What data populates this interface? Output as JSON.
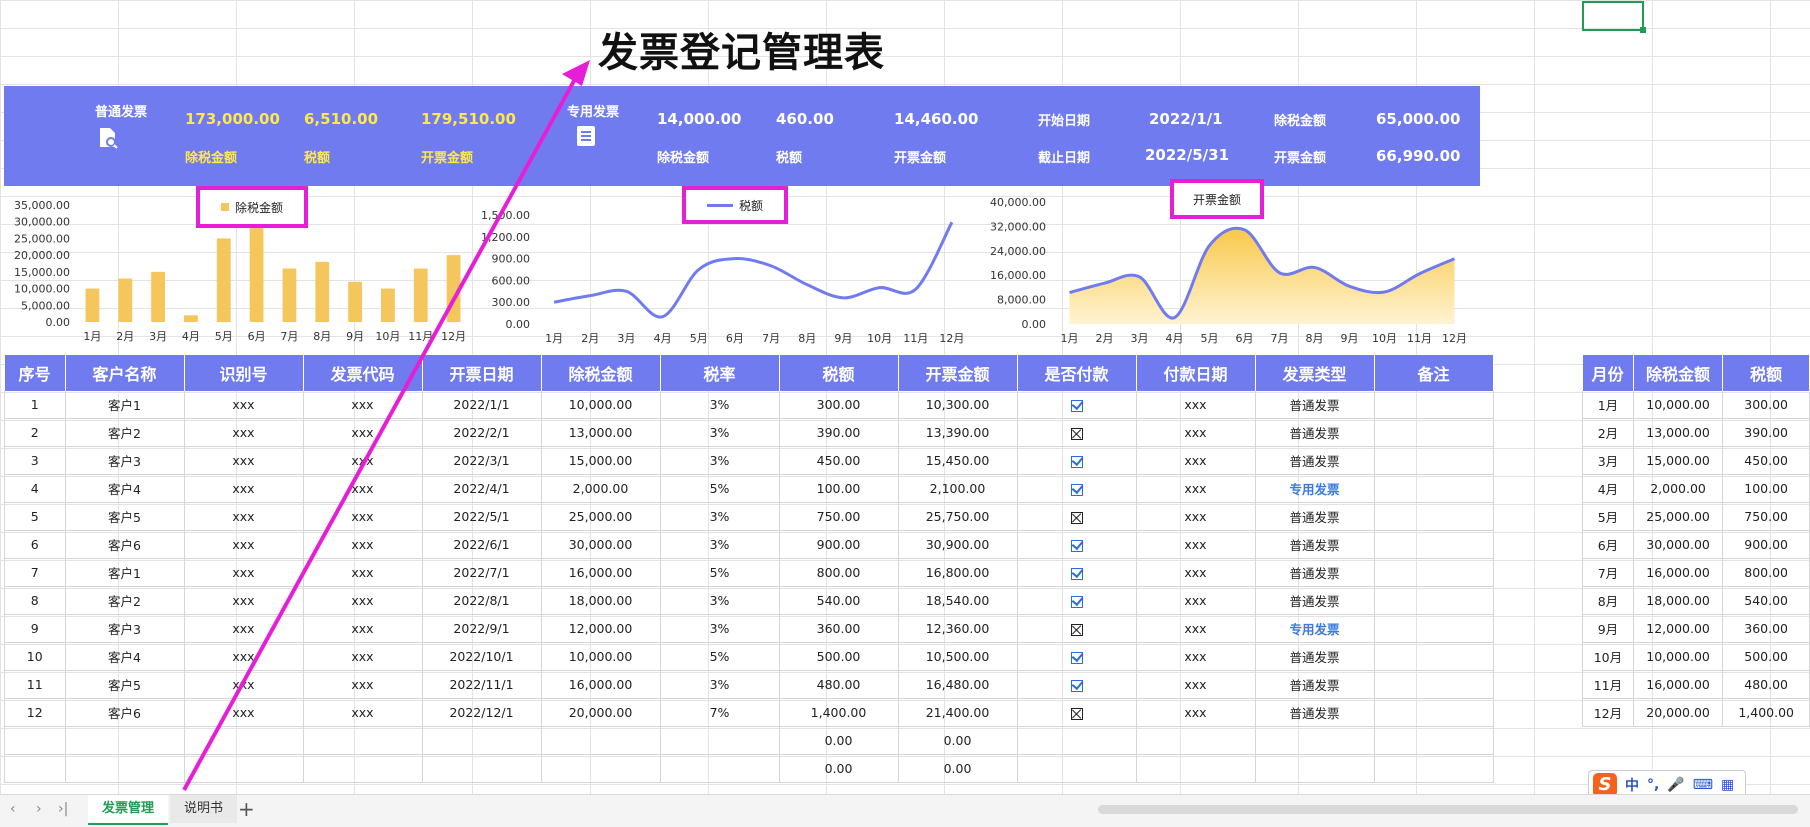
{
  "title": "发票登记管理表",
  "summary": {
    "ordinary_label": "普通发票",
    "ordinary_pretax": "173,000.00",
    "ordinary_tax": "6,510.00",
    "ordinary_total": "179,510.00",
    "ordinary_pretax_label": "除税金额",
    "ordinary_tax_label": "税额",
    "ordinary_total_label": "开票金额",
    "special_label": "专用发票",
    "special_pretax": "14,000.00",
    "special_tax": "460.00",
    "special_total": "14,460.00",
    "special_pretax_label": "除税金额",
    "special_tax_label": "税额",
    "special_total_label": "开票金额",
    "start_label": "开始日期",
    "start_value": "2022/1/1",
    "end_label": "截止日期",
    "end_value": "2022/5/31",
    "range_pretax_label": "除税金额",
    "range_pretax_value": "65,000.00",
    "range_total_label": "开票金额",
    "range_total_value": "66,990.00"
  },
  "chart_data": [
    {
      "type": "bar",
      "categories": [
        "1月",
        "2月",
        "3月",
        "4月",
        "5月",
        "6月",
        "7月",
        "8月",
        "9月",
        "10月",
        "11月",
        "12月"
      ],
      "series": [
        {
          "name": "除税金额",
          "values": [
            10000,
            13000,
            15000,
            2000,
            25000,
            30000,
            16000,
            18000,
            12000,
            10000,
            16000,
            20000
          ]
        }
      ],
      "yticks": [
        "35,000.00",
        "30,000.00",
        "25,000.00",
        "20,000.00",
        "15,000.00",
        "10,000.00",
        "5,000.00",
        "0.00"
      ],
      "ylim": [
        0,
        35000
      ],
      "legend": "top-center",
      "color": "#f5c65c"
    },
    {
      "type": "line",
      "categories": [
        "1月",
        "2月",
        "3月",
        "4月",
        "5月",
        "6月",
        "7月",
        "8月",
        "9月",
        "10月",
        "11月",
        "12月"
      ],
      "series": [
        {
          "name": "税额",
          "values": [
            300,
            390,
            450,
            100,
            750,
            900,
            800,
            540,
            360,
            500,
            480,
            1400
          ]
        }
      ],
      "yticks": [
        "1,500.00",
        "1,200.00",
        "900.00",
        "600.00",
        "300.00",
        "0.00"
      ],
      "ylim": [
        0,
        1500
      ],
      "legend": "top-center",
      "color": "#6f7bef"
    },
    {
      "type": "area",
      "categories": [
        "1月",
        "2月",
        "3月",
        "4月",
        "5月",
        "6月",
        "7月",
        "8月",
        "9月",
        "10月",
        "11月",
        "12月"
      ],
      "series": [
        {
          "name": "开票金额",
          "values": [
            10300,
            13390,
            15450,
            2100,
            25750,
            30900,
            16800,
            18540,
            12360,
            10500,
            16480,
            21400
          ]
        }
      ],
      "yticks": [
        "40,000.00",
        "32,000.00",
        "24,000.00",
        "16,000.00",
        "8,000.00",
        "0.00"
      ],
      "ylim": [
        0,
        40000
      ],
      "legend": "top-center",
      "color": "#6f7bef"
    }
  ],
  "table": {
    "headers": [
      "序号",
      "客户名称",
      "识别号",
      "发票代码",
      "开票日期",
      "除税金额",
      "税率",
      "税额",
      "开票金额",
      "是否付款",
      "付款日期",
      "发票类型",
      "备注"
    ],
    "rows": [
      [
        "1",
        "客户1",
        "xxx",
        "xxx",
        "2022/1/1",
        "10,000.00",
        "3%",
        "300.00",
        "10,300.00",
        true,
        "xxx",
        "普通发票",
        ""
      ],
      [
        "2",
        "客户2",
        "xxx",
        "xxx",
        "2022/2/1",
        "13,000.00",
        "3%",
        "390.00",
        "13,390.00",
        false,
        "xxx",
        "普通发票",
        ""
      ],
      [
        "3",
        "客户3",
        "xxx",
        "xxx",
        "2022/3/1",
        "15,000.00",
        "3%",
        "450.00",
        "15,450.00",
        true,
        "xxx",
        "普通发票",
        ""
      ],
      [
        "4",
        "客户4",
        "xxx",
        "xxx",
        "2022/4/1",
        "2,000.00",
        "5%",
        "100.00",
        "2,100.00",
        true,
        "xxx",
        "专用发票",
        ""
      ],
      [
        "5",
        "客户5",
        "xxx",
        "xxx",
        "2022/5/1",
        "25,000.00",
        "3%",
        "750.00",
        "25,750.00",
        false,
        "xxx",
        "普通发票",
        ""
      ],
      [
        "6",
        "客户6",
        "xxx",
        "xxx",
        "2022/6/1",
        "30,000.00",
        "3%",
        "900.00",
        "30,900.00",
        true,
        "xxx",
        "普通发票",
        ""
      ],
      [
        "7",
        "客户1",
        "xxx",
        "xxx",
        "2022/7/1",
        "16,000.00",
        "5%",
        "800.00",
        "16,800.00",
        true,
        "xxx",
        "普通发票",
        ""
      ],
      [
        "8",
        "客户2",
        "xxx",
        "xxx",
        "2022/8/1",
        "18,000.00",
        "3%",
        "540.00",
        "18,540.00",
        true,
        "xxx",
        "普通发票",
        ""
      ],
      [
        "9",
        "客户3",
        "xxx",
        "xxx",
        "2022/9/1",
        "12,000.00",
        "3%",
        "360.00",
        "12,360.00",
        false,
        "xxx",
        "专用发票",
        ""
      ],
      [
        "10",
        "客户4",
        "xxx",
        "xxx",
        "2022/10/1",
        "10,000.00",
        "5%",
        "500.00",
        "10,500.00",
        true,
        "xxx",
        "普通发票",
        ""
      ],
      [
        "11",
        "客户5",
        "xxx",
        "xxx",
        "2022/11/1",
        "16,000.00",
        "3%",
        "480.00",
        "16,480.00",
        true,
        "xxx",
        "普通发票",
        ""
      ],
      [
        "12",
        "客户6",
        "xxx",
        "xxx",
        "2022/12/1",
        "20,000.00",
        "7%",
        "1,400.00",
        "21,400.00",
        false,
        "xxx",
        "普通发票",
        ""
      ],
      [
        "",
        "",
        "",
        "",
        "",
        "",
        "",
        "0.00",
        "0.00",
        null,
        "",
        "",
        ""
      ],
      [
        "",
        "",
        "",
        "",
        "",
        "",
        "",
        "0.00",
        "0.00",
        null,
        "",
        "",
        ""
      ]
    ]
  },
  "side_table": {
    "headers": [
      "月份",
      "除税金额",
      "税额"
    ],
    "rows": [
      [
        "1月",
        "10,000.00",
        "300.00"
      ],
      [
        "2月",
        "13,000.00",
        "390.00"
      ],
      [
        "3月",
        "15,000.00",
        "450.00"
      ],
      [
        "4月",
        "2,000.00",
        "100.00"
      ],
      [
        "5月",
        "25,000.00",
        "750.00"
      ],
      [
        "6月",
        "30,000.00",
        "900.00"
      ],
      [
        "7月",
        "16,000.00",
        "800.00"
      ],
      [
        "8月",
        "18,000.00",
        "540.00"
      ],
      [
        "9月",
        "12,000.00",
        "360.00"
      ],
      [
        "10月",
        "10,000.00",
        "500.00"
      ],
      [
        "11月",
        "16,000.00",
        "480.00"
      ],
      [
        "12月",
        "20,000.00",
        "1,400.00"
      ]
    ]
  },
  "tabs": {
    "active": "发票管理",
    "second": "说明书",
    "add": "+",
    "nav_first": "‹",
    "nav_prev": "›",
    "nav_last": "›|"
  },
  "ime": {
    "logo": "S",
    "mode": "中",
    "punct": "°,",
    "mic": "🎤",
    "keyboard": "⌨",
    "menu": "▦"
  },
  "colors": {
    "band": "#6f7bef",
    "highlight_text": "#ffe84a",
    "annotation": "#e61fd6",
    "accent_green": "#1f9d55"
  }
}
